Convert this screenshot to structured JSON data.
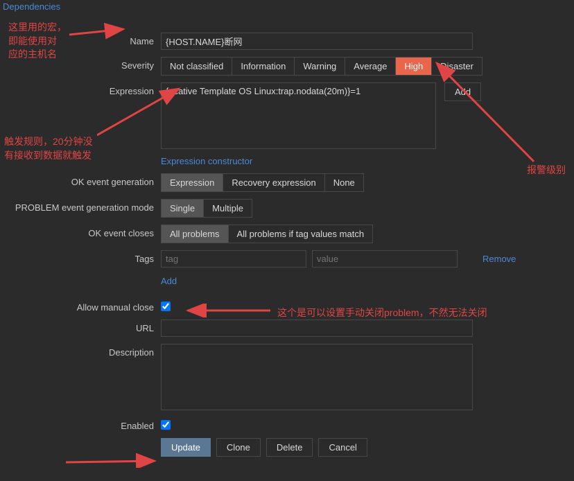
{
  "topLink": "Dependencies",
  "form": {
    "name_label": "Name",
    "name_value": "{HOST.NAME}断网",
    "severity_label": "Severity",
    "severity_options": [
      "Not classified",
      "Information",
      "Warning",
      "Average",
      "High",
      "Disaster"
    ],
    "severity_active": "High",
    "expression_label": "Expression",
    "expression_value": "{acative Template OS Linux:trap.nodata(20m)}=1",
    "add_btn": "Add",
    "expression_constructor": "Expression constructor",
    "ok_event_gen_label": "OK event generation",
    "ok_event_gen_options": [
      "Expression",
      "Recovery expression",
      "None"
    ],
    "ok_event_gen_active": "Expression",
    "problem_gen_label": "PROBLEM event generation mode",
    "problem_gen_options": [
      "Single",
      "Multiple"
    ],
    "problem_gen_active": "Single",
    "ok_closes_label": "OK event closes",
    "ok_closes_options": [
      "All problems",
      "All problems if tag values match"
    ],
    "ok_closes_active": "All problems",
    "tags_label": "Tags",
    "tag_placeholder": "tag",
    "value_placeholder": "value",
    "remove": "Remove",
    "add_link": "Add",
    "allow_manual_label": "Allow manual close",
    "url_label": "URL",
    "description_label": "Description",
    "enabled_label": "Enabled",
    "buttons": {
      "update": "Update",
      "clone": "Clone",
      "delete": "Delete",
      "cancel": "Cancel"
    }
  },
  "annotations": {
    "macro": "这里用的宏，\n即能使用对\n应的主机名",
    "trigger_rule": "触发规则，20分钟没\n有接收到数据就触发",
    "alarm_level": "报警级别",
    "manual_close": "这个是可以设置手动关闭problem，不然无法关闭"
  }
}
